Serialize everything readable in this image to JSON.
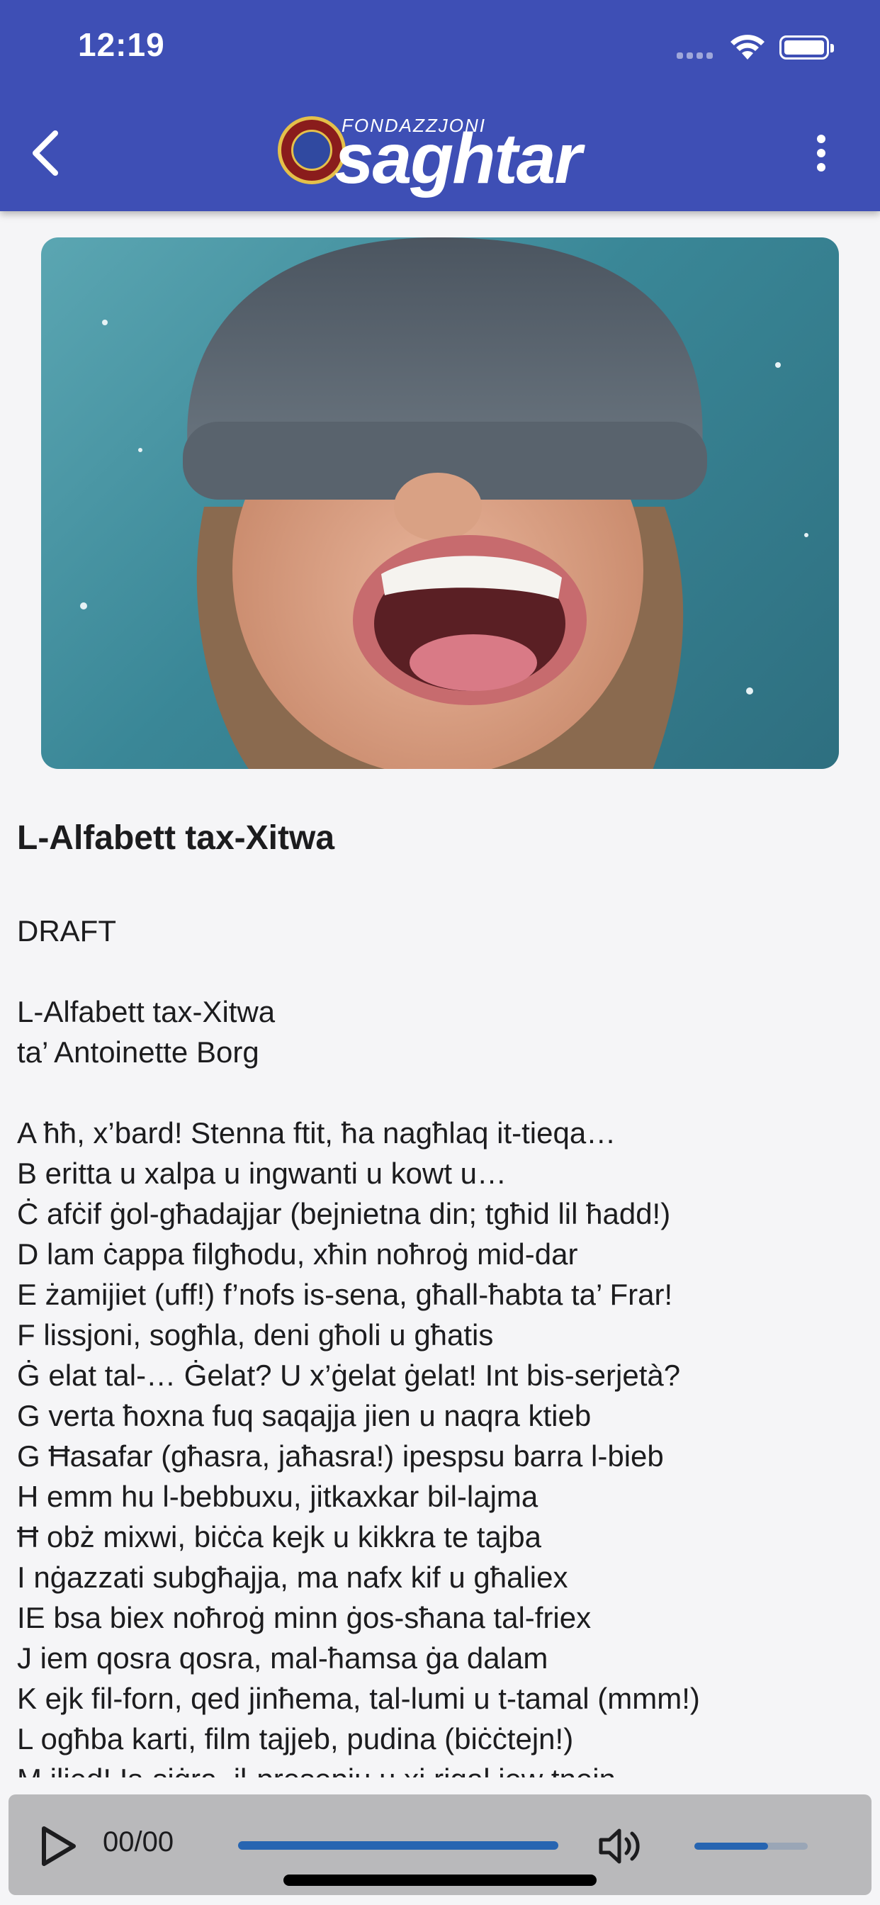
{
  "status_bar": {
    "time": "12:19"
  },
  "header": {
    "logo_small": "FONDAZZJONI",
    "logo_big": "saghtar",
    "back_icon": "chevron-left-icon",
    "menu_icon": "more-vertical-icon",
    "background": "#3e4fb5"
  },
  "hero_image": {
    "description_icon": "photo"
  },
  "article": {
    "title": "L-Alfabett tax-Xitwa",
    "draft_label": "DRAFT",
    "subtitle_line1": "L-Alfabett tax-Xitwa",
    "subtitle_line2": "ta’ Antoinette Borg",
    "lines": [
      "A ħħ, x’bard! Stenna ftit, ħa nagħlaq it-tieqa…",
      "B eritta u xalpa u ingwanti u kowt u…",
      "Ċ afċif ġol-għadajjar (bejnietna din; tgħid lil ħadd!)",
      "D lam ċappa filgħodu, xħin noħroġ mid-dar",
      "E żamijiet (uff!) f’nofs is-sena, għall-ħabta ta’ Frar!",
      "F lissjoni, sogħla, deni għoli u għatis",
      "Ġ elat tal-… Ġelat? U x’ġelat ġelat! Int bis-serjetà?",
      "G verta ħoxna fuq saqajja jien u naqra ktieb",
      "G Ħasafar (għasra, jaħasra!) ipespsu barra l-bieb",
      "H emm hu l-bebbuxu, jitkaxkar bil-lajma",
      "Ħ obż mixwi, biċċa kejk u kikkra te tajba",
      "I nġazzati subgħajja, ma nafx kif u għaliex",
      "IE bsa biex noħroġ minn ġos-sħana tal-friex",
      "J iem qosra qosra, mal-ħamsa ġa dalam",
      "K ejk fil-forn, qed jinħema, tal-lumi u t-tamal (mmm!)",
      "L ogħba karti, film tajjeb, pudina (biċċtejn!)",
      "M ilied! Is-siġra, il-presepju u xi rigal jew tnejn"
    ]
  },
  "player": {
    "time": "00/00",
    "progress": 1.0,
    "volume": 0.65,
    "accent": "#2765b1"
  }
}
